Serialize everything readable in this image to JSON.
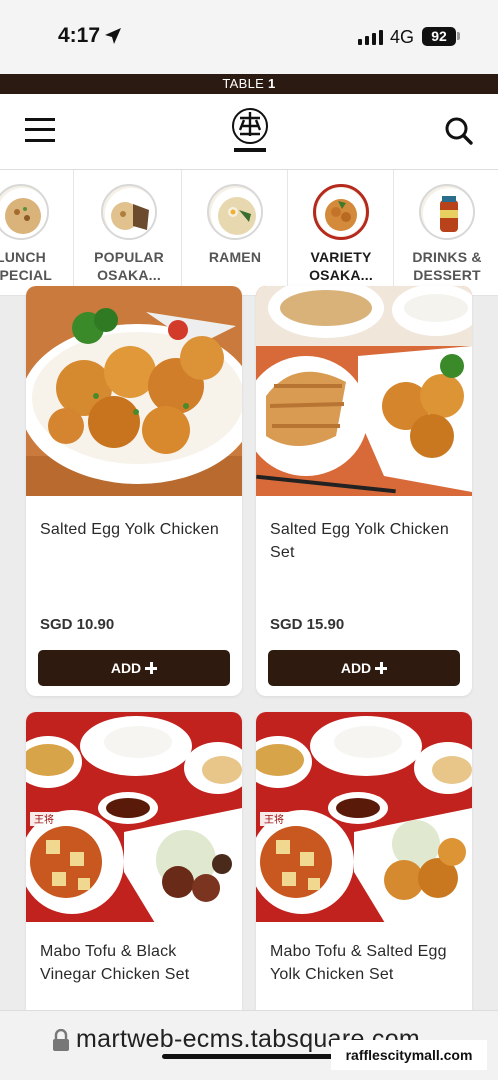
{
  "status_bar": {
    "time": "4:17",
    "network": "4G",
    "battery": "92"
  },
  "table_bar": {
    "prefix": "TABLE",
    "number": "1"
  },
  "header": {
    "logo_icon": "osaka-ohsho-logo",
    "menu_icon": "hamburger-icon",
    "search_icon": "search-icon"
  },
  "categories": [
    {
      "line1": "LUNCH",
      "line2": "SPECIAL",
      "active": false
    },
    {
      "line1": "POPULAR",
      "line2": "OSAKA...",
      "active": false
    },
    {
      "line1": "RAMEN",
      "line2": "",
      "active": false
    },
    {
      "line1": "VARIETY",
      "line2": "OSAKA...",
      "active": true
    },
    {
      "line1": "DRINKS &",
      "line2": "DESSERT",
      "active": false
    }
  ],
  "products": [
    {
      "name": "Salted Egg Yolk Chicken",
      "price": "SGD 10.90",
      "button": "ADD"
    },
    {
      "name": "Salted Egg Yolk Chicken Set",
      "price": "SGD 15.90",
      "button": "ADD"
    },
    {
      "name": "Mabo Tofu & Black Vinegar Chicken Set",
      "price": "",
      "button": ""
    },
    {
      "name": "Mabo Tofu & Salted Egg Yolk Chicken Set",
      "price": "",
      "button": ""
    }
  ],
  "url_bar": {
    "url": "martweb-ecms.tabsquare.com"
  },
  "watermark": "rafflescitymall.com",
  "colors": {
    "brand_dark": "#2f1a0f",
    "active_ring": "#b52a1d",
    "background": "#ececec"
  }
}
